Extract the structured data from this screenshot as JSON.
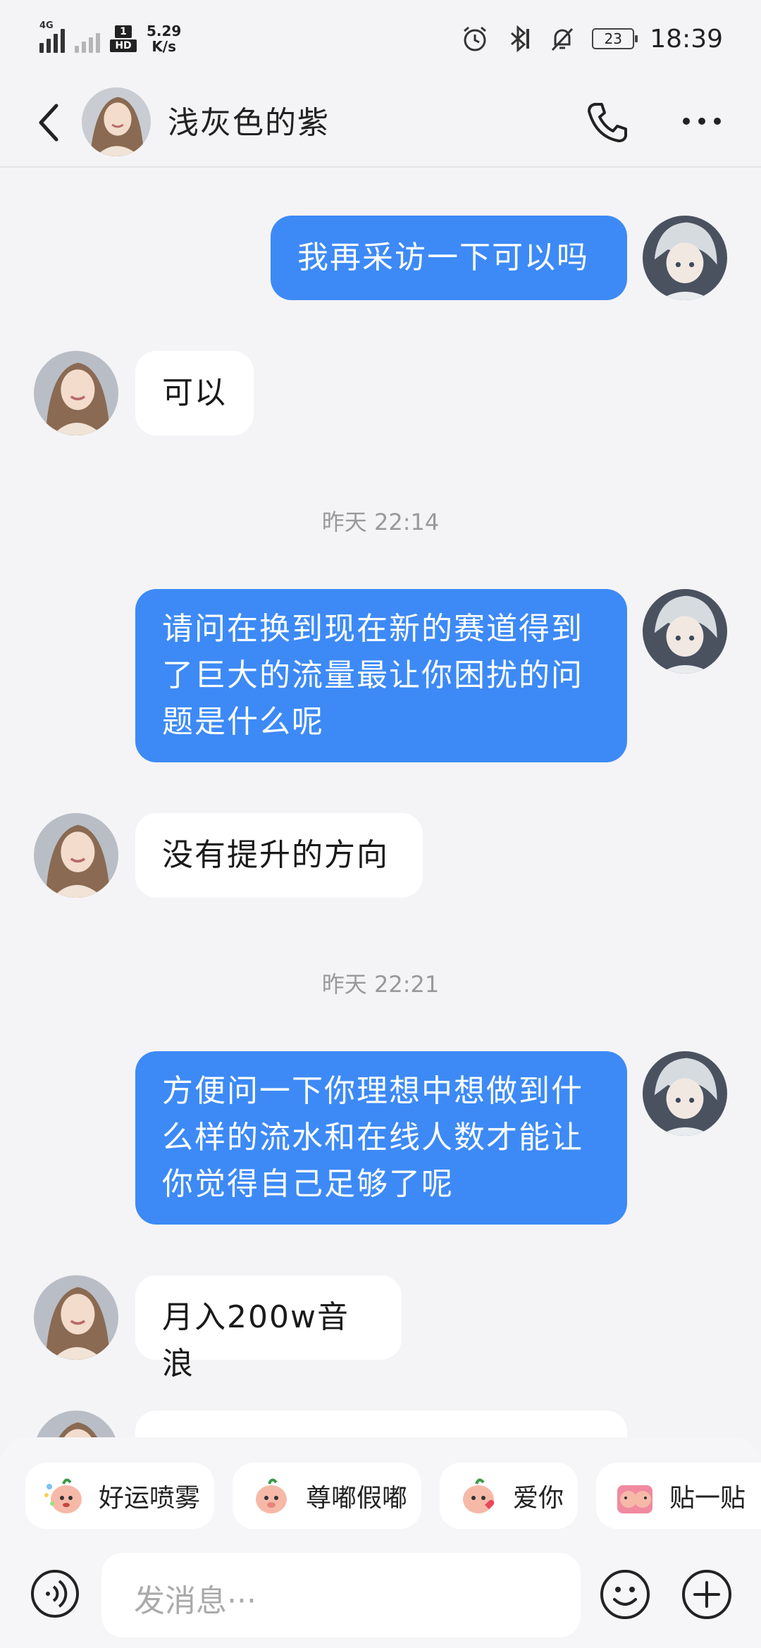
{
  "status_bar": {
    "network_type": "4G",
    "sim2_label": "1",
    "hd_label": "HD",
    "speed_value": "5.29",
    "speed_unit": "K/s",
    "battery": "23",
    "time": "18:39"
  },
  "header": {
    "contact_name": "浅灰色的紫"
  },
  "messages": [
    {
      "type": "message",
      "from": "me",
      "text": "我再采访一下可以吗"
    },
    {
      "type": "message",
      "from": "them",
      "text": "可以"
    },
    {
      "type": "time",
      "text": "昨天 22:14"
    },
    {
      "type": "message",
      "from": "me",
      "text": "请问在换到现在新的赛道得到了巨大的流量最让你困扰的问题是什么呢"
    },
    {
      "type": "message",
      "from": "them",
      "text": "没有提升的方向"
    },
    {
      "type": "time",
      "text": "昨天 22:21"
    },
    {
      "type": "message",
      "from": "me",
      "text": "方便问一下你理想中想做到什么样的流水和在线人数才能让你觉得自己足够了呢"
    },
    {
      "type": "message",
      "from": "them",
      "text": "月入200w音浪"
    }
  ],
  "quick_replies": [
    "好运喷雾",
    "尊嘟假嘟",
    "爱你",
    "贴一贴"
  ],
  "input": {
    "placeholder": "发消息···"
  },
  "colors": {
    "my_bubble": "#3d8af6",
    "their_bubble": "#ffffff",
    "background": "#f4f4f6"
  },
  "icons": [
    "back-arrow-icon",
    "phone-icon",
    "more-icon",
    "voice-icon",
    "emoji-icon",
    "plus-icon"
  ]
}
